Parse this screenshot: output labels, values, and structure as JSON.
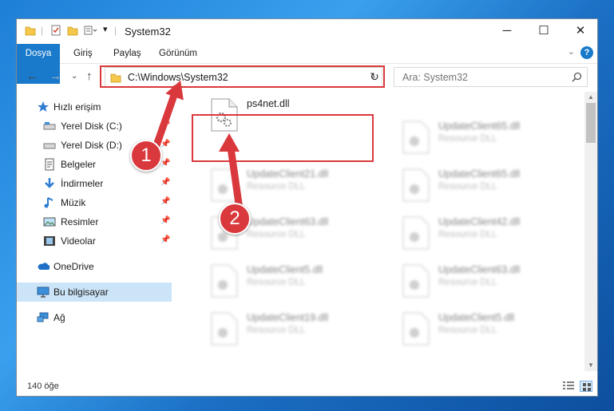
{
  "window": {
    "title": "System32",
    "minimize": "─",
    "maximize": "☐",
    "close": "✕"
  },
  "ribbon": {
    "tabs": [
      "Dosya",
      "Giriş",
      "Paylaş",
      "Görünüm"
    ],
    "help": "?"
  },
  "address": {
    "path": "C:\\Windows\\System32"
  },
  "search": {
    "placeholder": "Ara: System32"
  },
  "sidebar": {
    "items": [
      {
        "label": "Hızlı erişim",
        "icon": "star-icon"
      },
      {
        "label": "Yerel Disk (C:)",
        "icon": "drive-icon"
      },
      {
        "label": "Yerel Disk (D:)",
        "icon": "drive-icon"
      },
      {
        "label": "Belgeler",
        "icon": "documents-icon"
      },
      {
        "label": "İndirmeler",
        "icon": "download-icon"
      },
      {
        "label": "Müzik",
        "icon": "music-icon"
      },
      {
        "label": "Resimler",
        "icon": "pictures-icon"
      },
      {
        "label": "Videolar",
        "icon": "videos-icon"
      },
      {
        "label": "OneDrive",
        "icon": "cloud-icon"
      },
      {
        "label": "Bu bilgisayar",
        "icon": "computer-icon"
      },
      {
        "label": "Ağ",
        "icon": "network-icon"
      }
    ]
  },
  "files": {
    "highlighted": {
      "name": "ps4net.dll",
      "type": ""
    },
    "items": [
      {
        "name": "UpdateClient65.dll",
        "type": "Resource DLL"
      },
      {
        "name": "UpdateClient21.dll",
        "type": "Resource DLL"
      },
      {
        "name": "UpdateClient65.dll",
        "type": "Resource DLL"
      },
      {
        "name": "UpdateClient63.dll",
        "type": "Resource DLL"
      },
      {
        "name": "UpdateClient42.dll",
        "type": "Resource DLL"
      },
      {
        "name": "UpdateClient5.dll",
        "type": "Resource DLL"
      },
      {
        "name": "UpdateClient63.dll",
        "type": "Resource DLL"
      },
      {
        "name": "UpdateClient19.dll",
        "type": "Resource DLL"
      },
      {
        "name": "UpdateClient5.dll",
        "type": "Resource DLL"
      }
    ]
  },
  "status": {
    "count": "140 öğe"
  },
  "annotations": {
    "step1": "1",
    "step2": "2",
    "color": "#d9383c"
  }
}
